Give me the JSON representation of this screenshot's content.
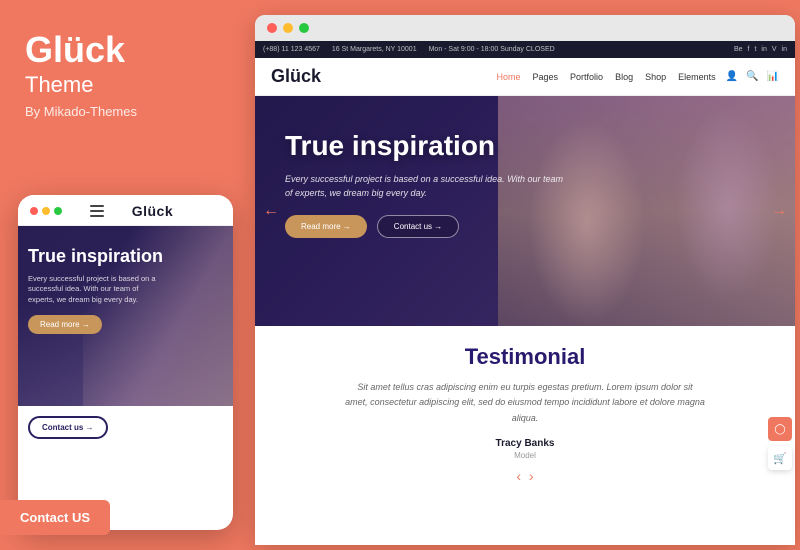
{
  "brand": {
    "name": "Glück",
    "subtitle": "Theme",
    "author": "By Mikado-Themes"
  },
  "browser_bar": {
    "phone": "(+88) 11 123 4567",
    "address": "16 St Margarets, NY 10001",
    "hours": "Mon - Sat 9:00 - 18:00 Sunday CLOSED",
    "social": [
      "Be",
      "f",
      "t",
      "in",
      "V",
      "in"
    ]
  },
  "nav": {
    "logo": "Glück",
    "links": [
      {
        "label": "Home",
        "active": true
      },
      {
        "label": "Pages",
        "active": false
      },
      {
        "label": "Portfolio",
        "active": false
      },
      {
        "label": "Blog",
        "active": false
      },
      {
        "label": "Shop",
        "active": false
      },
      {
        "label": "Elements",
        "active": false
      }
    ]
  },
  "hero": {
    "title": "True inspiration",
    "description": "Every successful project is based on a successful idea. With our team of experts, we dream big every day.",
    "btn_readmore": "Read more →",
    "btn_contactus": "Contact us →"
  },
  "mobile": {
    "logo": "Glück",
    "hero_title": "True inspiration",
    "hero_desc": "Every successful project is based on a successful idea. With our team of experts, we dream big every day.",
    "btn_readmore": "Read more →",
    "btn_contactus": "Contact us →"
  },
  "testimonial": {
    "title": "Testimonial",
    "text": "Sit amet tellus cras adipiscing enim eu turpis egestas pretium. Lorem ipsum dolor sit amet, consectetur adipiscing elit, sed do eiusmod tempo incididunt labore et dolore magna aliqua.",
    "author": "Tracy Banks",
    "role": "Model"
  },
  "contact_us_label": "Contact US",
  "window_dots": [
    "red",
    "yellow",
    "green"
  ],
  "colors": {
    "accent": "#F07860",
    "dark": "#1a1a2e",
    "purple": "#2a1a6e"
  }
}
